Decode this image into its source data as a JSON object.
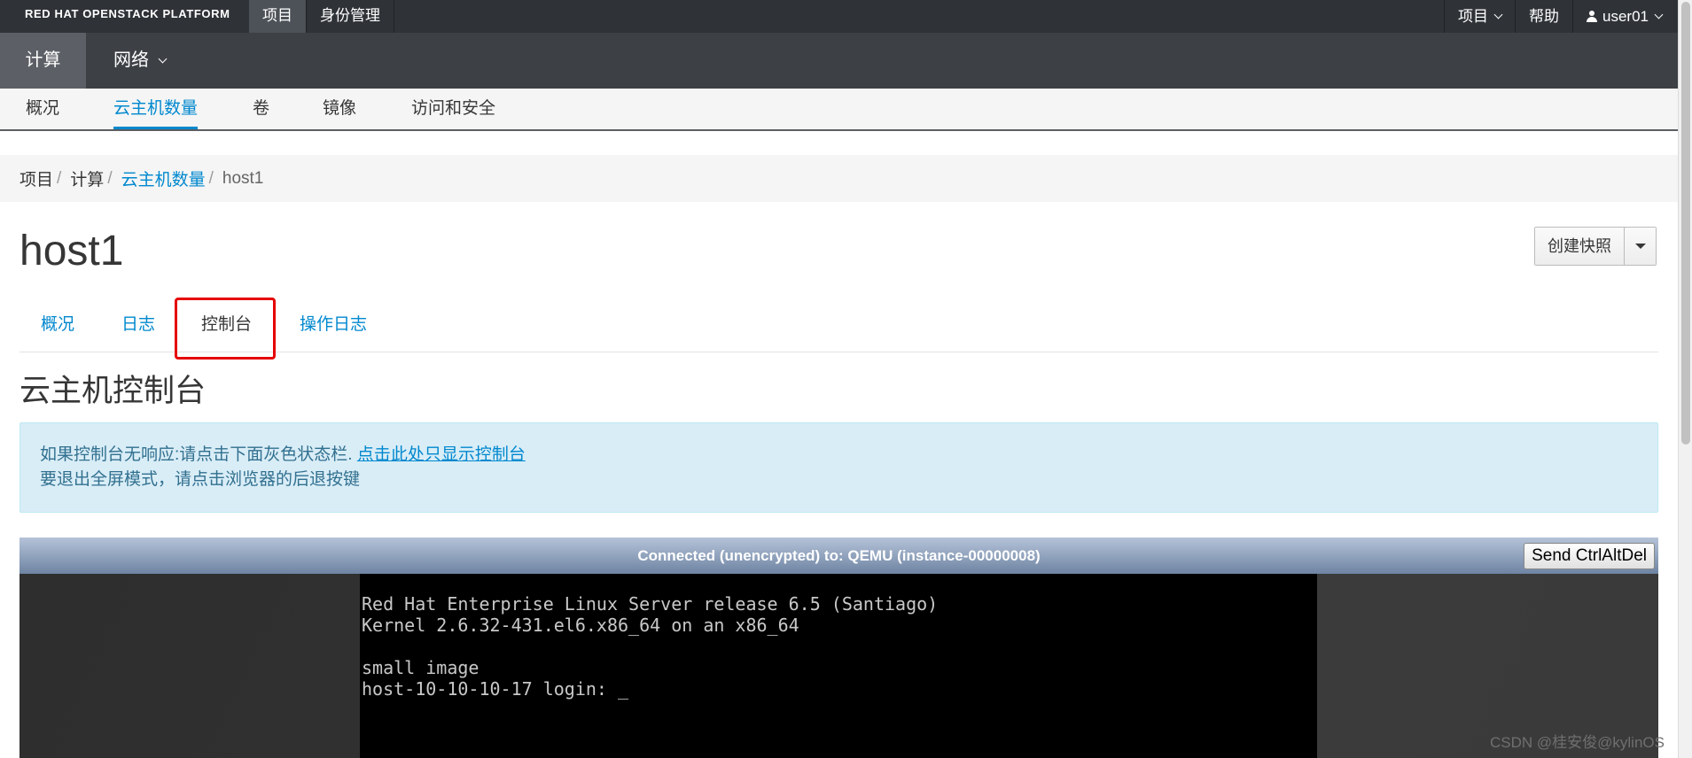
{
  "masthead": {
    "brand": "RED HAT OPENSTACK PLATFORM",
    "nav": [
      {
        "label": "项目",
        "active": true
      },
      {
        "label": "身份管理",
        "active": false
      }
    ],
    "right": {
      "project_menu": "项目",
      "help": "帮助",
      "user": "user01"
    }
  },
  "subnav": {
    "compute": "计算",
    "network": "网络"
  },
  "panelnav": {
    "items": [
      {
        "label": "概况",
        "active": false
      },
      {
        "label": "云主机数量",
        "active": true
      },
      {
        "label": "卷",
        "active": false
      },
      {
        "label": "镜像",
        "active": false
      },
      {
        "label": "访问和安全",
        "active": false
      }
    ]
  },
  "breadcrumb": {
    "items": [
      "项目",
      "计算",
      "云主机数量",
      "host1"
    ],
    "separator": "/"
  },
  "page": {
    "title": "host1",
    "action_button": "创建快照"
  },
  "tabs": {
    "items": [
      {
        "label": "概况",
        "active": false
      },
      {
        "label": "日志",
        "active": false
      },
      {
        "label": "控制台",
        "active": true
      },
      {
        "label": "操作日志",
        "active": false
      }
    ]
  },
  "console": {
    "title": "云主机控制台",
    "info_line1": "如果控制台无响应:请点击下面灰色状态栏. ",
    "info_link": "点击此处只显示控制台",
    "info_line2": "要退出全屏模式，请点击浏览器的后退按键",
    "status": "Connected (unencrypted) to: QEMU (instance-00000008)",
    "send_button": "Send CtrlAltDel",
    "screen_lines": [
      "Red Hat Enterprise Linux Server release 6.5 (Santiago)",
      "Kernel 2.6.32-431.el6.x86_64 on an x86_64",
      "",
      "small image",
      "host-10-10-10-17 login: _"
    ]
  },
  "watermark": "CSDN @桂安俊@kylinOS",
  "colors": {
    "masthead_bg": "#2f3338",
    "subnav_bg": "#3d4045",
    "link_blue": "#0088ce",
    "highlight_red": "#e60000",
    "alert_bg": "#d9edf7"
  }
}
